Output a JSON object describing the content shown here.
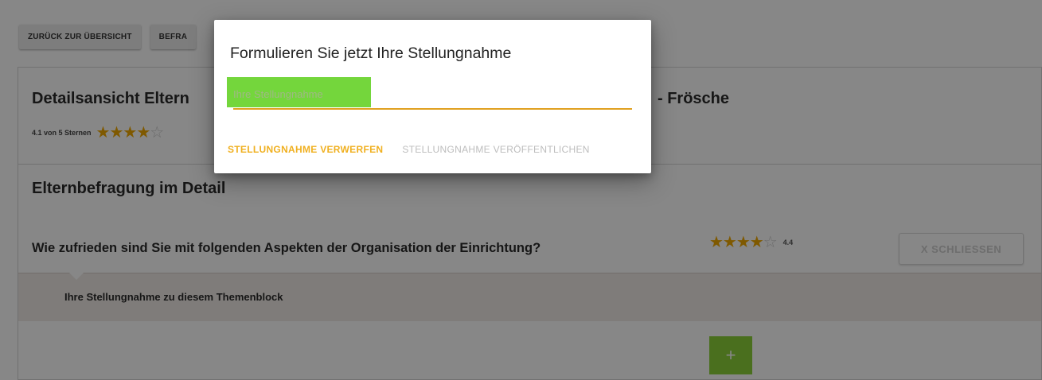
{
  "toolbar": {
    "back_label": "ZURÜCK ZUR ÜBERSICHT",
    "survey_label": "BEFRA"
  },
  "detail": {
    "title_left": "Detailsansicht Eltern",
    "title_right": "- Frösche",
    "rating_text": "4.1 von 5 Sternen",
    "stars_filled": "★★★★",
    "stars_empty": "☆"
  },
  "section": {
    "title": "Elternbefragung im Detail"
  },
  "question": {
    "text": "Wie zufrieden sind Sie mit folgenden Aspekten der Organisation der Einrichtung?",
    "stars_filled": "★★★★",
    "stars_empty": "☆",
    "score": "4.4",
    "close_label": "X SCHLIESSEN"
  },
  "stellungnahme": {
    "label": "Ihre Stellungnahme zu diesem Themenblock",
    "add_label": "+"
  },
  "dialog": {
    "title": "Formulieren Sie jetzt Ihre Stellungnahme",
    "input_placeholder": "Ihre Stellungnahme",
    "input_value": "",
    "discard_label": "STELLUNGNAHME VERWERFEN",
    "publish_label": "STELLUNGNAHME VERÖFFENTLICHEN"
  },
  "colors": {
    "accent_orange": "#f0b020",
    "accent_green": "#8cd23a",
    "star": "#f0a800"
  }
}
